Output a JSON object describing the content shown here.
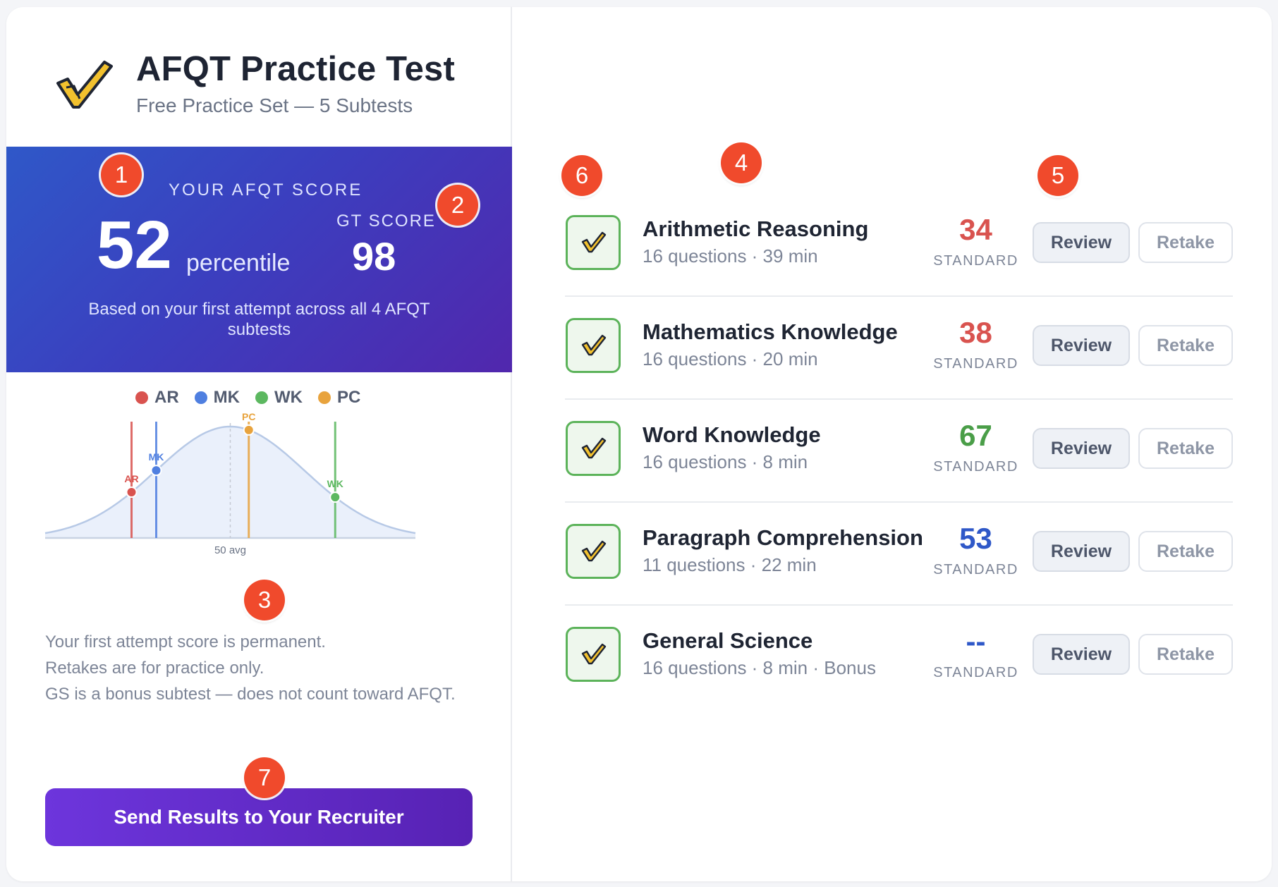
{
  "header": {
    "title": "AFQT Practice Test",
    "subtitle": "Free Practice Set — 5 Subtests",
    "logo_icon": "checkmark-icon"
  },
  "score": {
    "label": "YOUR AFQT SCORE",
    "value": "52",
    "unit": "percentile",
    "gt_label": "GT SCORE",
    "gt_value": "98",
    "note": "Based on your first attempt across all 4 AFQT subtests"
  },
  "chart_data": {
    "type": "line",
    "description_free": true,
    "legend": [
      {
        "code": "AR",
        "color": "#d9534f"
      },
      {
        "code": "MK",
        "color": "#4f7fe0"
      },
      {
        "code": "WK",
        "color": "#5cb860"
      },
      {
        "code": "PC",
        "color": "#e8a33d"
      }
    ],
    "markers": [
      {
        "code": "AR",
        "value": 34
      },
      {
        "code": "MK",
        "value": 38
      },
      {
        "code": "PC",
        "value": 53
      },
      {
        "code": "WK",
        "value": 67
      }
    ],
    "avg_label": "50 avg",
    "avg": 50,
    "xlim": [
      20,
      80
    ]
  },
  "notes": [
    "Your first attempt score is permanent.",
    "Retakes are for practice only.",
    "GS is a bonus subtest — does not count toward AFQT."
  ],
  "cta": {
    "label": "Send Results to Your Recruiter"
  },
  "subtests": [
    {
      "title": "Arithmetic Reasoning",
      "meta": "16 questions · 39 min",
      "score": "34",
      "score_color": "#d9534f",
      "std_label": "STANDARD",
      "review": "Review",
      "retake": "Retake"
    },
    {
      "title": "Mathematics Knowledge",
      "meta": "16 questions · 20 min",
      "score": "38",
      "score_color": "#d9534f",
      "std_label": "STANDARD",
      "review": "Review",
      "retake": "Retake"
    },
    {
      "title": "Word Knowledge",
      "meta": "16 questions · 8 min",
      "score": "67",
      "score_color": "#4a9e48",
      "std_label": "STANDARD",
      "review": "Review",
      "retake": "Retake"
    },
    {
      "title": "Paragraph Comprehension",
      "meta": "11 questions · 22 min",
      "score": "53",
      "score_color": "#2f58c8",
      "std_label": "STANDARD",
      "review": "Review",
      "retake": "Retake"
    },
    {
      "title": "General Science",
      "meta": "16 questions · 8 min · Bonus",
      "score": "--",
      "score_color": "#2f58c8",
      "std_label": "STANDARD",
      "review": "Review",
      "retake": "Retake"
    }
  ],
  "markers": [
    "1",
    "2",
    "3",
    "4",
    "5",
    "6",
    "7"
  ]
}
